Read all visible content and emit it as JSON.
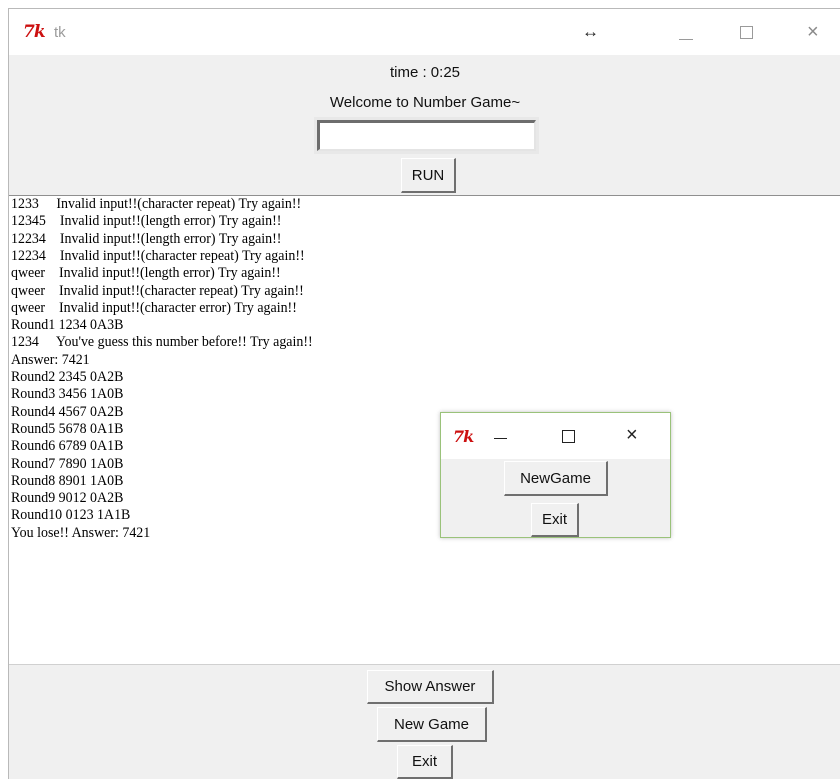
{
  "window": {
    "title": "tk",
    "resize_cursor": "↔",
    "logo_text": "7k"
  },
  "header": {
    "timer": "time : 0:25",
    "welcome": "Welcome to Number Game~",
    "input_value": "",
    "run_label": "RUN"
  },
  "log": [
    "1233     Invalid input!!(character repeat) Try again!!",
    "12345    Invalid input!!(length error) Try again!!",
    "12234    Invalid input!!(length error) Try again!!",
    "12234    Invalid input!!(character repeat) Try again!!",
    "qweer    Invalid input!!(length error) Try again!!",
    "qweer    Invalid input!!(character repeat) Try again!!",
    "qweer    Invalid input!!(character error) Try again!!",
    "Round1 1234 0A3B",
    "1234     You've guess this number before!! Try again!!",
    "Answer: 7421",
    "Round2 2345 0A2B",
    "Round3 3456 1A0B",
    "Round4 4567 0A2B",
    "Round5 5678 0A1B",
    "Round6 6789 0A1B",
    "Round7 7890 1A0B",
    "Round8 8901 1A0B",
    "Round9 9012 0A2B",
    "Round10 0123 1A1B",
    "You lose!! Answer: 7421"
  ],
  "bottom": {
    "show_answer_label": "Show Answer",
    "new_game_label": "New Game",
    "exit_label": "Exit"
  },
  "popup": {
    "new_game_label": "NewGame",
    "exit_label": "Exit"
  },
  "icons": {
    "close": "×"
  },
  "colors": {
    "tk_logo": "#cc1010",
    "popup_border": "#9ac27a",
    "window_bg": "#f0f0f0"
  }
}
